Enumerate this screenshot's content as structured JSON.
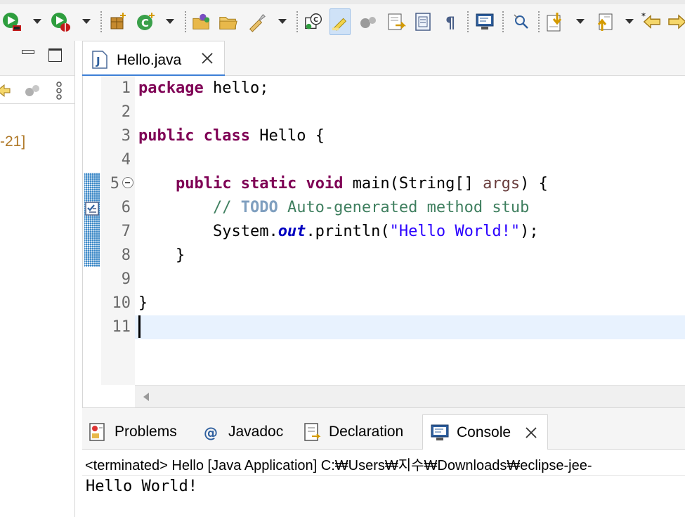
{
  "toolbar": {
    "icons": [
      "run-icon",
      "debug-icon",
      "new-package-icon",
      "new-class-icon",
      "open-type-icon",
      "open-folder-icon",
      "search-icon",
      "toggle-breakpoint-icon",
      "toggle-mark-occurrences-icon",
      "skip-breakpoints-icon",
      "next-annotation-icon",
      "block-selection-icon",
      "show-whitespace-icon",
      "toggle-console-icon",
      "search-references-icon",
      "next-edit-icon",
      "previous-edit-icon",
      "back-icon",
      "forward-icon"
    ]
  },
  "left_panel": {
    "visible_text": "-21]"
  },
  "editor": {
    "tab_title": "Hello.java",
    "line_numbers": [
      "1",
      "2",
      "3",
      "4",
      "5",
      "6",
      "7",
      "8",
      "9",
      "10",
      "11"
    ],
    "code": {
      "l1_kw": "package",
      "l1_rest": " hello;",
      "l3_kw1": "public",
      "l3_kw2": "class",
      "l3_rest": " Hello {",
      "l5_indent": "    ",
      "l5_kw1": "public",
      "l5_kw2": "static",
      "l5_kw3": "void",
      "l5_mid": " main(String[] ",
      "l5_param": "args",
      "l5_end": ") {",
      "l6_indent": "        ",
      "l6_comment_start": "// ",
      "l6_todo": "TODO",
      "l6_comment_rest": " Auto-generated method stub",
      "l7_indent": "        ",
      "l7_obj": "System.",
      "l7_field": "out",
      "l7_call": ".println(",
      "l7_str": "\"Hello World!\"",
      "l7_end": ");",
      "l8_text": "    }",
      "l10_text": "}"
    }
  },
  "views": {
    "tabs": [
      {
        "label": "Problems",
        "icon": "problems-icon"
      },
      {
        "label": "Javadoc",
        "icon": "javadoc-icon"
      },
      {
        "label": "Declaration",
        "icon": "declaration-icon"
      },
      {
        "label": "Console",
        "icon": "console-icon"
      }
    ],
    "active": "Console"
  },
  "console": {
    "status": "<terminated> Hello [Java Application] C:₩Users₩지수₩Downloads₩eclipse-jee-",
    "output": "Hello World!"
  },
  "colors": {
    "keyword": "#7f0055",
    "string": "#2a00ff",
    "comment": "#3f7f5f",
    "task_tag": "#7f9fbf",
    "field": "#0000c0",
    "current_line": "#e8f2fe",
    "tab_underline": "#3d7fd6"
  }
}
